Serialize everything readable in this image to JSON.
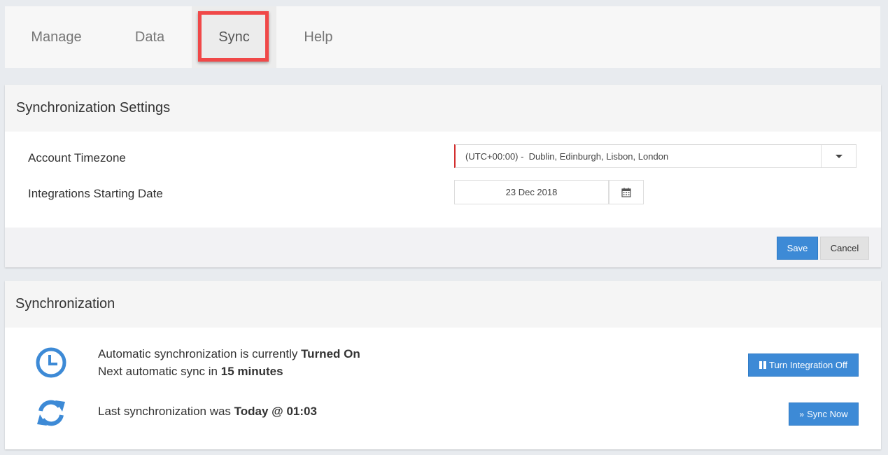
{
  "tabs": [
    {
      "label": "Manage"
    },
    {
      "label": "Data"
    },
    {
      "label": "Sync"
    },
    {
      "label": "Help"
    }
  ],
  "settings": {
    "title": "Synchronization Settings",
    "timezone_label": "Account Timezone",
    "timezone_value": "(UTC+00:00) -  Dublin, Edinburgh, Lisbon, London",
    "start_date_label": "Integrations Starting Date",
    "start_date_value": "23 Dec 2018",
    "save_label": "Save",
    "cancel_label": "Cancel"
  },
  "sync": {
    "title": "Synchronization",
    "auto_prefix": "Automatic synchronization is currently ",
    "auto_status": "Turned On",
    "next_prefix": "Next automatic sync in ",
    "next_value": "15 minutes",
    "last_prefix": "Last synchronization was ",
    "last_value": "Today @ 01:03",
    "turn_off_label": "Turn Integration Off",
    "sync_now_label": "Sync Now"
  },
  "colors": {
    "accent_blue": "#3d8ad6",
    "highlight_red": "#f04848",
    "required_red": "#d32f2f"
  },
  "icons": [
    "clock-icon",
    "refresh-icon",
    "calendar-icon",
    "chevron-down-icon",
    "pause-icon",
    "double-chevron-right-icon"
  ]
}
